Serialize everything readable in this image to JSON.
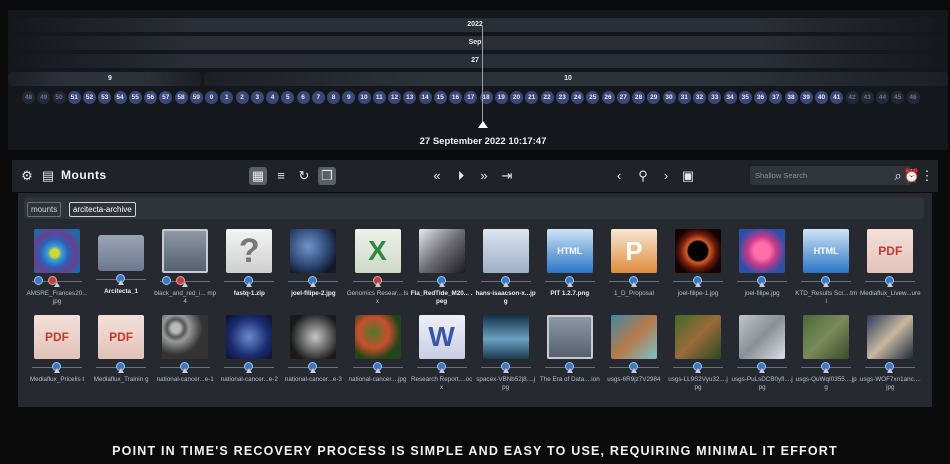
{
  "timeline": {
    "year": "2022",
    "month": "Sep",
    "day": "27",
    "hour_prev": "9",
    "hour_current": "10",
    "ticks_prev": [
      "48",
      "49",
      "50",
      "51",
      "52",
      "53",
      "54",
      "55",
      "56",
      "57",
      "58",
      "59"
    ],
    "ticks_current": [
      "0",
      "1",
      "2",
      "3",
      "4",
      "5",
      "6",
      "7",
      "8",
      "9",
      "10",
      "11",
      "12",
      "13",
      "14",
      "15",
      "16",
      "17",
      "18",
      "19",
      "20",
      "21",
      "22",
      "23",
      "24",
      "25",
      "26",
      "27",
      "28",
      "29",
      "30",
      "31",
      "32",
      "33",
      "34",
      "35",
      "36",
      "37",
      "38",
      "39",
      "40",
      "41",
      "42",
      "43",
      "44",
      "45",
      "46"
    ],
    "selected_datetime": "27 September 2022 10:17:47"
  },
  "toolbar": {
    "title": "Mounts",
    "search_placeholder": "Shallow Search",
    "icons": [
      "app-icon",
      "archive-icon",
      "grid-view-icon",
      "list-view-icon",
      "refresh-icon",
      "clone-icon",
      "rewind-icon",
      "play-icon",
      "fast-forward-icon",
      "skip-end-icon",
      "prev-icon",
      "pin-icon",
      "next-icon",
      "document-icon",
      "search-icon",
      "alarm-icon",
      "more-icon"
    ]
  },
  "breadcrumbs": [
    "mounts",
    "arcitecta-archive"
  ],
  "files": [
    {
      "name": "AMSRE_Frances20...jpg",
      "thumb": "t-sat",
      "dots": [
        "blue",
        "red"
      ],
      "bold": false
    },
    {
      "name": "Arcitecta_1",
      "thumb": "t-folder",
      "dots": [
        "blue"
      ],
      "bold": true
    },
    {
      "name": "black_and_red_i... mp4",
      "thumb": "t-film",
      "dots": [
        "blue",
        "red"
      ],
      "bold": false
    },
    {
      "name": "fastq-1.zip",
      "thumb": "t-q",
      "dots": [
        "blue"
      ],
      "bold": true,
      "glyph": "?"
    },
    {
      "name": "joel-filipe-2.jpg",
      "thumb": "t-earth",
      "dots": [
        "blue"
      ],
      "bold": true
    },
    {
      "name": "Genomics Resear....lsx",
      "thumb": "t-xls",
      "dots": [
        "red"
      ],
      "bold": false,
      "glyph": "X"
    },
    {
      "name": "Fla_RedTide_M20... .peg",
      "thumb": "t-bw",
      "dots": [
        "blue"
      ],
      "bold": true
    },
    {
      "name": "hans-isaacson-x...jpg",
      "thumb": "t-doc",
      "dots": [
        "blue"
      ],
      "bold": true
    },
    {
      "name": "PIT 1.2.7.png",
      "thumb": "t-html",
      "dots": [
        "blue"
      ],
      "bold": true,
      "glyph": "HTML"
    },
    {
      "name": "1_D_Proposal",
      "thumb": "t-ppt",
      "dots": [
        "blue"
      ],
      "bold": false,
      "glyph": "P"
    },
    {
      "name": "joel-filipe-1.jpg",
      "thumb": "t-sun",
      "dots": [
        "blue"
      ],
      "bold": false
    },
    {
      "name": "joel-filipe.jpg",
      "thumb": "t-pink",
      "dots": [
        "blue"
      ],
      "bold": false
    },
    {
      "name": "KTD_Results Scr....tml",
      "thumb": "t-html",
      "dots": [
        "blue"
      ],
      "bold": false,
      "glyph": "HTML"
    },
    {
      "name": "Mediaflux_Livew...ure",
      "thumb": "t-pdf",
      "dots": [
        "blue"
      ],
      "bold": false,
      "glyph": "PDF"
    },
    {
      "name": "Mediaflux_Pricelis t",
      "thumb": "t-pdf",
      "dots": [
        "blue"
      ],
      "bold": false,
      "glyph": "PDF"
    },
    {
      "name": "Mediaflux_Trainin g",
      "thumb": "t-pdf",
      "dots": [
        "blue"
      ],
      "bold": false,
      "glyph": "PDF"
    },
    {
      "name": "national-cancer...e-1",
      "thumb": "t-cells",
      "dots": [
        "blue"
      ],
      "bold": false
    },
    {
      "name": "national-cancer...e-2",
      "thumb": "t-blue",
      "dots": [
        "blue"
      ],
      "bold": false
    },
    {
      "name": "national-cancer...e-3",
      "thumb": "t-tumor",
      "dots": [
        "blue"
      ],
      "bold": false
    },
    {
      "name": "national-cancer....jpg",
      "thumb": "t-tissue",
      "dots": [
        "blue"
      ],
      "bold": false
    },
    {
      "name": "Research Report....ocx",
      "thumb": "t-word",
      "dots": [
        "blue"
      ],
      "bold": false,
      "glyph": "W"
    },
    {
      "name": "spacex-VBNb52j8....jpg",
      "thumb": "t-whale",
      "dots": [
        "blue"
      ],
      "bold": false
    },
    {
      "name": "The Era of Data....ion",
      "thumb": "t-film",
      "dots": [
        "blue"
      ],
      "bold": false
    },
    {
      "name": "usgs-6R9jz7V2984",
      "thumb": "t-land1",
      "dots": [
        "blue"
      ],
      "bold": false
    },
    {
      "name": "usgs-LL9S2Vyu32....jpg",
      "thumb": "t-land2",
      "dots": [
        "blue"
      ],
      "bold": false
    },
    {
      "name": "usgs-PuLsDCB0yfl....jpg",
      "thumb": "t-land3",
      "dots": [
        "blue"
      ],
      "bold": false
    },
    {
      "name": "usgs-QuWqI0355....jpg",
      "thumb": "t-land4",
      "dots": [
        "blue"
      ],
      "bold": false
    },
    {
      "name": "usgs-WOF7xn1anc....jpg",
      "thumb": "t-lab",
      "dots": [
        "blue"
      ],
      "bold": false
    }
  ],
  "caption": "POINT IN TIME'S RECOVERY PROCESS IS SIMPLE AND EASY TO USE, REQUIRING MINIMAL IT EFFORT"
}
